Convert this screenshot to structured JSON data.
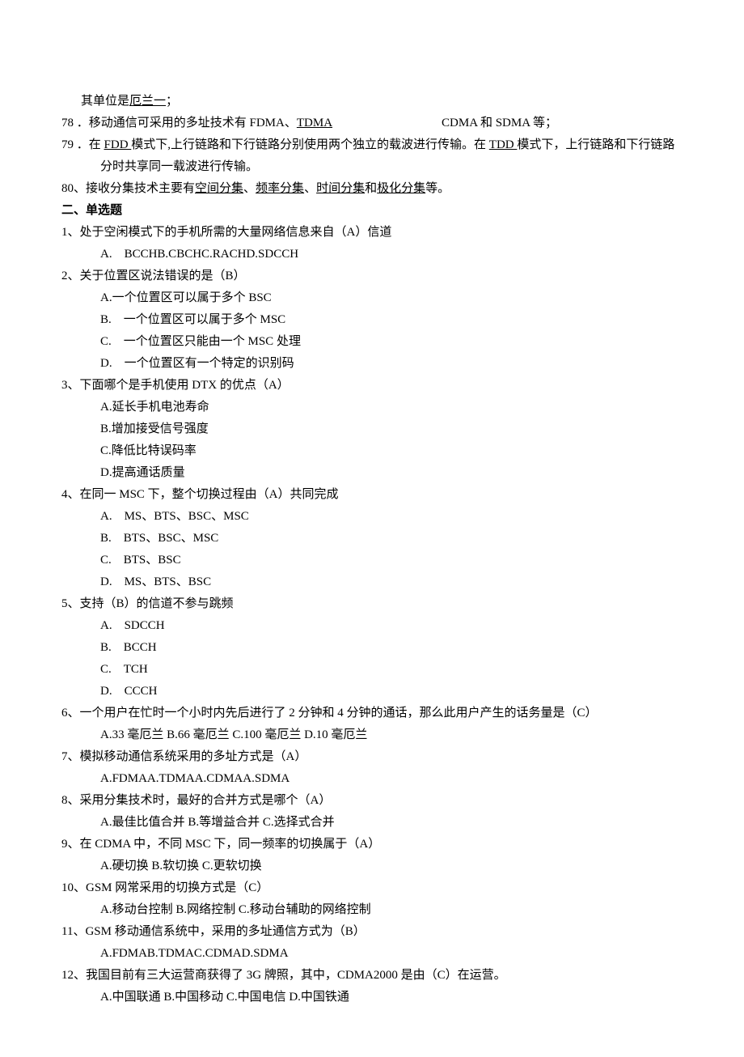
{
  "pre": {
    "l1": "其单位是",
    "l1u": "厄兰一",
    "l1end": "；",
    "l78_no": "78",
    "l78_a": " ．移动通信可采用的多址技术有 FDMA、",
    "l78_u": "TDMA",
    "l78_b": "CDMA 和 SDMA 等；",
    "l79_no": "79",
    "l79_a": " ．在 ",
    "l79_u1": "FDD ",
    "l79_b": "模式下,上行链路和下行链路分别使用两个独立的载波进行传输。在 ",
    "l79_u2": "TDD ",
    "l79_c": "模式下，上行链路和下行链路",
    "l79_d": "分时共享同一载波进行传输。",
    "l80_a": "80、接收分集技术主要有",
    "l80_u1": "空间分集",
    "l80_s1": "、",
    "l80_u2": "频率分集",
    "l80_s2": "、",
    "l80_u3": "时间分集",
    "l80_s3": "和",
    "l80_u4": "极化分集",
    "l80_end": "等。"
  },
  "section2": "二、单选题",
  "q1": {
    "stem": "1、处于空闲模式下的手机所需的大量网络信息来自（A）信道",
    "opt": "A.　BCCHB.CBCHC.RACHD.SDCCH"
  },
  "q2": {
    "stem": "2、关于位置区说法错误的是（B）",
    "a": "A.一个位置区可以属于多个 BSC",
    "b": "B.　一个位置区可以属于多个 MSC",
    "c": "C.　一个位置区只能由一个 MSC 处理",
    "d": "D.　一个位置区有一个特定的识别码"
  },
  "q3": {
    "stem": "3、下面哪个是手机使用 DTX 的优点（A）",
    "a": "A.延长手机电池寿命",
    "b": "B.增加接受信号强度",
    "c": "C.降低比特误码率",
    "d": "D.提高通话质量"
  },
  "q4": {
    "stem": "4、在同一 MSC 下，整个切换过程由（A）共同完成",
    "a": "A.　MS、BTS、BSC、MSC",
    "b": "B.　BTS、BSC、MSC",
    "c": "C.　BTS、BSC",
    "d": "D.　MS、BTS、BSC"
  },
  "q5": {
    "stem": "5、支持（B）的信道不参与跳频",
    "a": "A.　SDCCH",
    "b": "B.　BCCH",
    "c": "C.　TCH",
    "d": "D.　CCCH"
  },
  "q6": {
    "stem": "6、一个用户在忙时一个小时内先后进行了 2 分钟和 4 分钟的通话，那么此用户产生的话务量是（C）",
    "opt": "A.33 毫厄兰 B.66 毫厄兰 C.100 毫厄兰 D.10 毫厄兰"
  },
  "q7": {
    "stem": "7、模拟移动通信系统采用的多址方式是（A）",
    "opt": "A.FDMAA.TDMAA.CDMAA.SDMA"
  },
  "q8": {
    "stem": "8、采用分集技术时，最好的合并方式是哪个（A）",
    "opt": "A.最佳比值合并 B.等增益合并 C.选择式合并"
  },
  "q9": {
    "stem": "9、在 CDMA 中，不同 MSC 下，同一频率的切换属于（A）",
    "opt": "A.硬切换 B.软切换 C.更软切换"
  },
  "q10": {
    "stem": "10、GSM 网常采用的切换方式是（C）",
    "opt": "A.移动台控制 B.网络控制 C.移动台辅助的网络控制"
  },
  "q11": {
    "stem": "11、GSM 移动通信系统中，采用的多址通信方式为（B）",
    "opt": "A.FDMAB.TDMAC.CDMAD.SDMA"
  },
  "q12": {
    "stem": "12、我国目前有三大运营商获得了 3G 牌照，其中，CDMA2000 是由（C）在运营。",
    "opt": "A.中国联通 B.中国移动 C.中国电信 D.中国铁通"
  }
}
